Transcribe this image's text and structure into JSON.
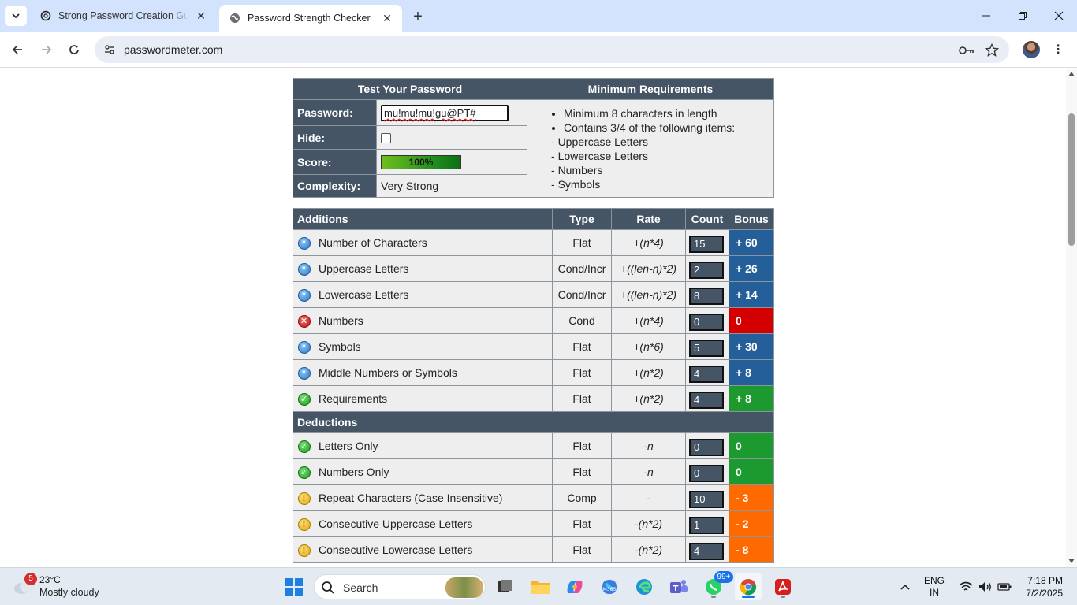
{
  "browser": {
    "tabs": [
      {
        "title": "Strong Password Creation Guid",
        "active": false
      },
      {
        "title": "Password Strength Checker",
        "active": true
      }
    ],
    "url": "passwordmeter.com"
  },
  "page": {
    "test_header": "Test Your Password",
    "requirements_header": "Minimum Requirements",
    "password_label": "Password:",
    "password_value": "mu!mu!mu!gu@PT#",
    "hide_label": "Hide:",
    "score_label": "Score:",
    "score_value": "100%",
    "score_fraction": 1.0,
    "complexity_label": "Complexity:",
    "complexity_value": "Very Strong",
    "requirements": [
      "Minimum 8 characters in length",
      "Contains 3/4 of the following items:"
    ],
    "requirement_items": [
      "- Uppercase Letters",
      "- Lowercase Letters",
      "- Numbers",
      "- Symbols"
    ],
    "additions_header": "Additions",
    "deductions_header": "Deductions",
    "col_type": "Type",
    "col_rate": "Rate",
    "col_count": "Count",
    "col_bonus": "Bonus",
    "additions": [
      {
        "icon": "star-icon",
        "name": "Number of Characters",
        "type": "Flat",
        "rate": "+(n*4)",
        "count": "15",
        "bonus": "+ 60",
        "bonus_color": "#245f9a"
      },
      {
        "icon": "star-icon",
        "name": "Uppercase Letters",
        "type": "Cond/Incr",
        "rate": "+((len-n)*2)",
        "count": "2",
        "bonus": "+ 26",
        "bonus_color": "#245f9a"
      },
      {
        "icon": "star-icon",
        "name": "Lowercase Letters",
        "type": "Cond/Incr",
        "rate": "+((len-n)*2)",
        "count": "8",
        "bonus": "+ 14",
        "bonus_color": "#245f9a"
      },
      {
        "icon": "fail-icon",
        "name": "Numbers",
        "type": "Cond",
        "rate": "+(n*4)",
        "count": "0",
        "bonus": "0",
        "bonus_color": "#d40000"
      },
      {
        "icon": "star-icon",
        "name": "Symbols",
        "type": "Flat",
        "rate": "+(n*6)",
        "count": "5",
        "bonus": "+ 30",
        "bonus_color": "#245f9a"
      },
      {
        "icon": "star-icon",
        "name": "Middle Numbers or Symbols",
        "type": "Flat",
        "rate": "+(n*2)",
        "count": "4",
        "bonus": "+ 8",
        "bonus_color": "#245f9a"
      },
      {
        "icon": "pass-icon",
        "name": "Requirements",
        "type": "Flat",
        "rate": "+(n*2)",
        "count": "4",
        "bonus": "+ 8",
        "bonus_color": "#1d9a2f"
      }
    ],
    "deductions": [
      {
        "icon": "pass-icon",
        "name": "Letters Only",
        "type": "Flat",
        "rate": "-n",
        "count": "0",
        "bonus": "0",
        "bonus_color": "#1d9a2f"
      },
      {
        "icon": "pass-icon",
        "name": "Numbers Only",
        "type": "Flat",
        "rate": "-n",
        "count": "0",
        "bonus": "0",
        "bonus_color": "#1d9a2f"
      },
      {
        "icon": "warning-icon",
        "name": "Repeat Characters (Case Insensitive)",
        "type": "Comp",
        "rate": "-",
        "count": "10",
        "bonus": "- 3",
        "bonus_color": "#ff6a00"
      },
      {
        "icon": "warning-icon",
        "name": "Consecutive Uppercase Letters",
        "type": "Flat",
        "rate": "-(n*2)",
        "count": "1",
        "bonus": "- 2",
        "bonus_color": "#ff6a00"
      },
      {
        "icon": "warning-icon",
        "name": "Consecutive Lowercase Letters",
        "type": "Flat",
        "rate": "-(n*2)",
        "count": "4",
        "bonus": "- 8",
        "bonus_color": "#ff6a00"
      }
    ]
  },
  "taskbar": {
    "weather_badge": "5",
    "temperature": "23°C",
    "condition": "Mostly cloudy",
    "search_placeholder": "Search",
    "whatsapp_badge": "99+",
    "lang_line1": "ENG",
    "lang_line2": "IN",
    "time": "7:18 PM",
    "date": "7/2/2025"
  }
}
